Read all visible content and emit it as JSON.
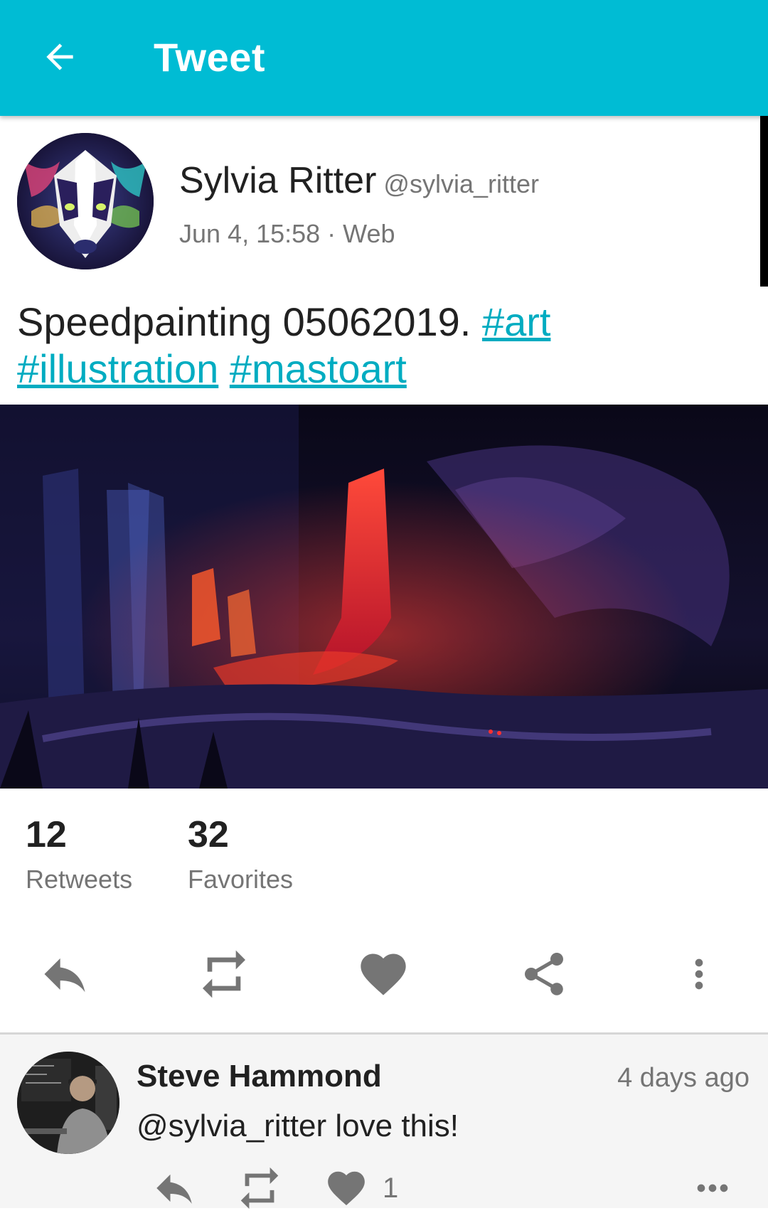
{
  "app_bar": {
    "title": "Tweet",
    "back_icon": "arrow-left-icon",
    "background": "#00BCD4"
  },
  "status": {
    "author_name": "Sylvia Ritter",
    "author_handle": "@sylvia_ritter",
    "meta": "Jun 4, 15:58 · Web",
    "text_plain": "Speedpainting 05062019.",
    "hashtags": [
      "#art",
      "#illustration",
      "#mastoart"
    ],
    "hashtag_color": "#00ACC1",
    "avatar_icon": "badger-avatar"
  },
  "stats": {
    "retweets_count": "12",
    "retweets_label": "Retweets",
    "favorites_count": "32",
    "favorites_label": "Favorites"
  },
  "actions": {
    "icons": [
      "reply-icon",
      "retweet-icon",
      "heart-icon",
      "share-icon",
      "more-vertical-icon"
    ]
  },
  "reply": {
    "author_name": "Steve Hammond",
    "time": "4 days ago",
    "text": "@sylvia_ritter love this!",
    "favorites_count": "1",
    "icons": [
      "reply-icon",
      "retweet-icon",
      "heart-icon",
      "more-horizontal-icon"
    ]
  }
}
